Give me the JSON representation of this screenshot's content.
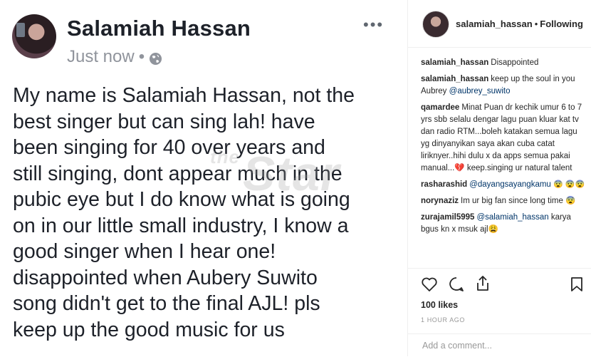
{
  "facebook": {
    "author": "Salamiah Hassan",
    "timestamp": "Just now",
    "separator": "•",
    "body_lines": [
      "My name is Salamiah Hassan, not the",
      "best singer but can sing lah! have",
      "been singing for 40 over years and",
      "still singing, dont appear much in the",
      "pubic eye but I do know what is going",
      "on in our little small industry, I know a",
      "good singer when I hear one!",
      "disappointed when Aubery Suwito",
      "song didn't get to the final AJL! pls",
      "keep up the good music for us"
    ],
    "watermark_prefix": "the",
    "watermark": "Star"
  },
  "instagram": {
    "username": "salamiah_hassan",
    "dot": "•",
    "follow_status": "Following",
    "comments": [
      {
        "user": "salamiah_hassan",
        "text": "Disappointed"
      },
      {
        "user": "salamiah_hassan",
        "text": "keep up the soul in you Aubrey",
        "mention": "@aubrey_suwito"
      },
      {
        "user": "qamardee",
        "text": "Minat Puan dr kechik umur 6 to 7 yrs sbb selalu dengar lagu puan kluar kat tv dan radio RTM...boleh katakan semua lagu yg dinyanyikan saya akan cuba catat liriknyer..hihi dulu x da apps semua pakai manual...💔 keep.singing ur natural talent"
      },
      {
        "user": "rasharashid",
        "mention": "@dayangsayangkamu",
        "text": "😨 😨😨"
      },
      {
        "user": "norynaziz",
        "text": "Im ur big fan since long time 😨"
      },
      {
        "user": "zurajamil5995",
        "mention": "@salamiah_hassan",
        "text": "karya bgus kn x msuk ajl😩"
      }
    ],
    "likes": "100 likes",
    "time": "1 HOUR AGO",
    "add_comment_placeholder": "Add a comment..."
  }
}
